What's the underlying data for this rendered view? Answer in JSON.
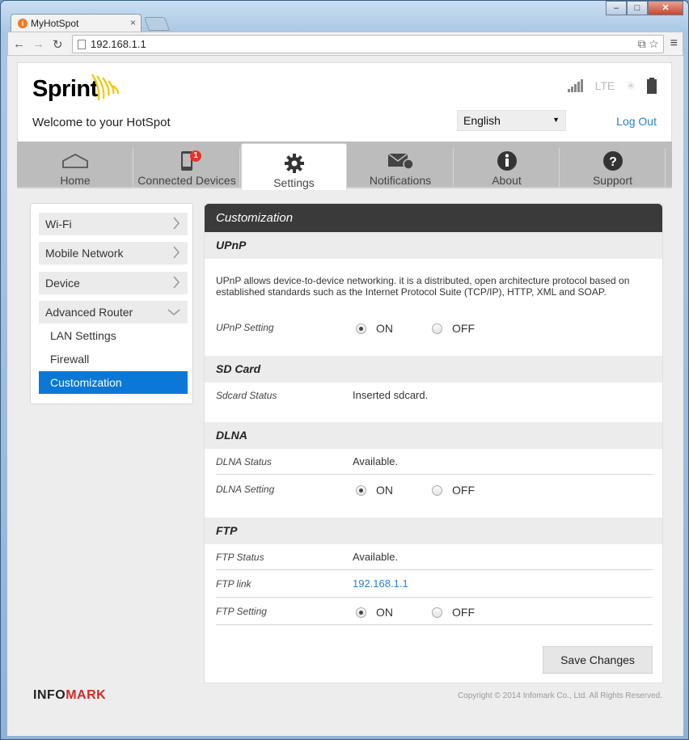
{
  "browser": {
    "tab_title": "MyHotSpot",
    "address": "192.168.1.1"
  },
  "header": {
    "brand": "Sprint",
    "welcome": "Welcome to your HotSpot",
    "network_type": "LTE",
    "language": "English",
    "logout": "Log Out"
  },
  "nav": {
    "items": [
      {
        "label": "Home",
        "icon": "home-icon"
      },
      {
        "label": "Connected Devices",
        "icon": "phone-icon",
        "badge": "1"
      },
      {
        "label": "Settings",
        "icon": "gear-icon"
      },
      {
        "label": "Notifications",
        "icon": "envelope-icon"
      },
      {
        "label": "About",
        "icon": "info-icon"
      },
      {
        "label": "Support",
        "icon": "question-icon"
      }
    ],
    "active": "Settings"
  },
  "sidebar": {
    "items": [
      "Wi-Fi",
      "Mobile Network",
      "Device",
      "Advanced Router"
    ],
    "subitems": [
      "LAN Settings",
      "Firewall",
      "Customization"
    ],
    "active": "Customization"
  },
  "panel": {
    "title": "Customization",
    "upnp": {
      "heading": "UPnP",
      "description": "UPnP allows device-to-device networking. it is a distributed, open architecture protocol based on established standards such as the Internet Protocol Suite (TCP/IP), HTTP, XML and SOAP.",
      "setting_label": "UPnP Setting",
      "on_label": "ON",
      "off_label": "OFF",
      "value": "ON"
    },
    "sdcard": {
      "heading": "SD Card",
      "status_label": "Sdcard Status",
      "status_value": "Inserted sdcard."
    },
    "dlna": {
      "heading": "DLNA",
      "status_label": "DLNA Status",
      "status_value": "Available.",
      "setting_label": "DLNA Setting",
      "on_label": "ON",
      "off_label": "OFF",
      "value": "ON"
    },
    "ftp": {
      "heading": "FTP",
      "status_label": "FTP Status",
      "status_value": "Available.",
      "link_label": "FTP link",
      "link_value": "192.168.1.1",
      "setting_label": "FTP Setting",
      "on_label": "ON",
      "off_label": "OFF",
      "value": "ON"
    },
    "save_label": "Save Changes"
  },
  "footer": {
    "logo_part1": "INFO",
    "logo_part2": "MARK",
    "copyright": "Copyright © 2014 Infomark Co., Ltd. All Rights Reserved."
  },
  "colors": {
    "accent_blue": "#0b78d8",
    "link_blue": "#2b83c7",
    "panel_header": "#3a3a3a",
    "badge_red": "#e8332a",
    "sprint_yellow": "#f5c400"
  }
}
